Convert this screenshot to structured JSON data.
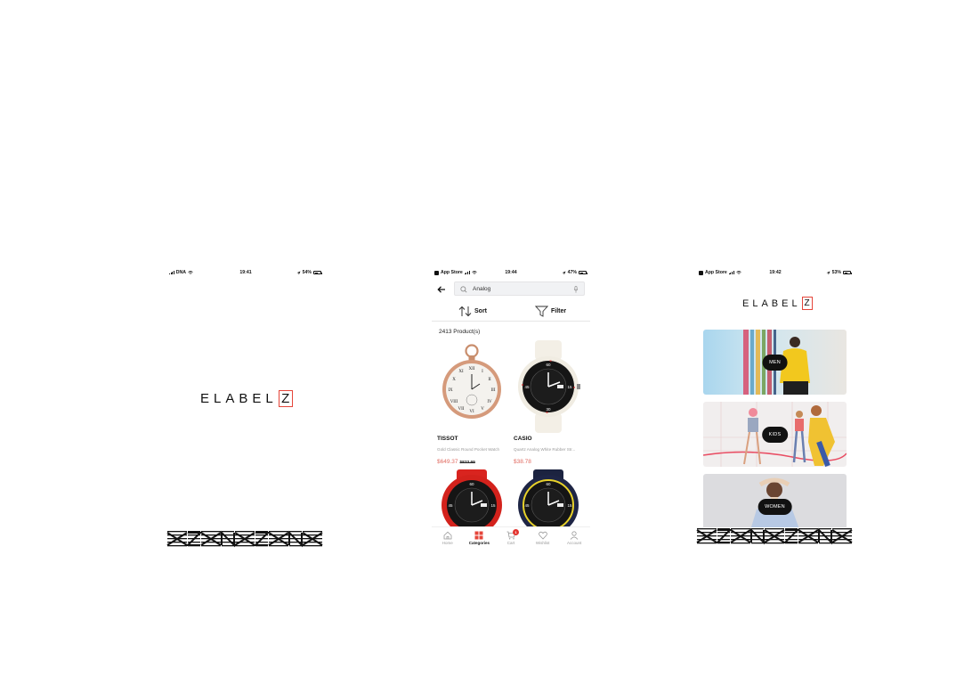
{
  "screens": {
    "splash": {
      "status": {
        "carrier": "DNA",
        "time": "19:41",
        "battery": "54%",
        "battery_level": 0.54
      },
      "logo": {
        "text": "ELABEL",
        "accent": "Z"
      }
    },
    "search": {
      "status": {
        "back_app": "App Store",
        "time": "19:44",
        "battery": "47%",
        "battery_level": 0.47
      },
      "search_value": "Analog",
      "sort_label": "Sort",
      "filter_label": "Filter",
      "count": "2413 Product(s)",
      "products": [
        {
          "brand": "TISSOT",
          "name": "Gold Classic Round Pocket Watch",
          "price": "$649.37",
          "old_price": "$833.69"
        },
        {
          "brand": "CASIO",
          "name": "Quartz Analog White Rubber Str...",
          "price": "$38.78",
          "old_price": ""
        },
        {
          "brand": "",
          "name": "",
          "price": "",
          "old_price": ""
        },
        {
          "brand": "",
          "name": "",
          "price": "",
          "old_price": ""
        }
      ],
      "tabs": [
        {
          "label": "Home",
          "icon": "home-icon"
        },
        {
          "label": "Categories",
          "icon": "grid-icon"
        },
        {
          "label": "Cart",
          "icon": "cart-icon",
          "badge": "1"
        },
        {
          "label": "Wishlist",
          "icon": "heart-icon"
        },
        {
          "label": "Account",
          "icon": "user-icon"
        }
      ]
    },
    "categories": {
      "status": {
        "back_app": "App Store",
        "time": "19:42",
        "battery": "53%",
        "battery_level": 0.53
      },
      "logo": {
        "text": "ELABEL",
        "accent": "Z"
      },
      "items": [
        "MEN",
        "KIDS",
        "WOMEN"
      ]
    }
  },
  "colors": {
    "accent": "#e5453a",
    "price": "#e06a60",
    "badge": "#e3342f",
    "active_tab": "#e5453a"
  }
}
